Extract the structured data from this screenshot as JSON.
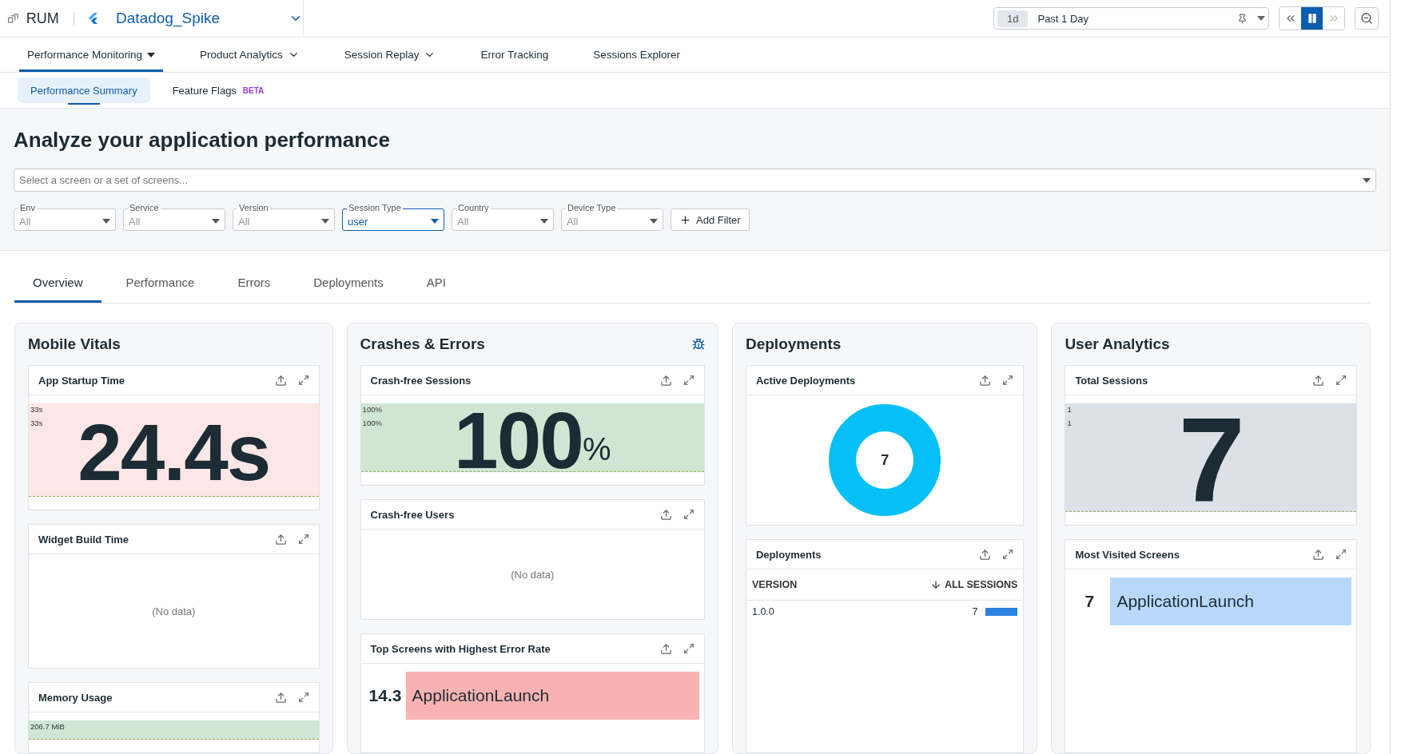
{
  "app_bar": {
    "product": "RUM",
    "application": "Datadog_Spike",
    "time_range": {
      "chip": "1d",
      "label": "Past 1 Day"
    },
    "playback": {
      "paused": true
    }
  },
  "nav": [
    {
      "label": "Performance Monitoring",
      "selected": true,
      "kind": "caret"
    },
    {
      "label": "Product Analytics",
      "selected": false,
      "kind": "chevron"
    },
    {
      "label": "Session Replay",
      "selected": false,
      "kind": "chevron"
    },
    {
      "label": "Error Tracking",
      "selected": false,
      "kind": "plain"
    },
    {
      "label": "Sessions Explorer",
      "selected": false,
      "kind": "plain"
    }
  ],
  "subnav": [
    {
      "label": "Performance Summary",
      "selected": true
    },
    {
      "label": "Feature Flags",
      "selected": false,
      "badge": "BETA"
    }
  ],
  "page_title": "Analyze your application performance",
  "screen_select": {
    "placeholder": "Select a screen or a set of screens..."
  },
  "filters": [
    {
      "label": "Env",
      "value": "All",
      "active": false
    },
    {
      "label": "Service",
      "value": "All",
      "active": false
    },
    {
      "label": "Version",
      "value": "All",
      "active": false
    },
    {
      "label": "Session Type",
      "value": "user",
      "active": true
    },
    {
      "label": "Country",
      "value": "All",
      "active": false
    },
    {
      "label": "Device Type",
      "value": "All",
      "active": false
    }
  ],
  "add_filter": "Add Filter",
  "tabs": [
    {
      "label": "Overview",
      "selected": true
    },
    {
      "label": "Performance",
      "selected": false
    },
    {
      "label": "Errors",
      "selected": false
    },
    {
      "label": "Deployments",
      "selected": false
    },
    {
      "label": "API",
      "selected": false
    }
  ],
  "sections": [
    {
      "title": "Mobile Vitals",
      "widgets": [
        {
          "kind": "value",
          "title": "App Startup Time",
          "color": "#fde6e6",
          "axis": [
            "33s",
            "33s"
          ],
          "value": "24.4s"
        },
        {
          "kind": "nodata",
          "title": "Widget Build Time",
          "message": "(No data)"
        },
        {
          "kind": "value",
          "title": "Memory Usage",
          "color": "#cfe6d2",
          "axis": [
            "206.7 MiB"
          ]
        }
      ]
    },
    {
      "title": "Crashes & Errors",
      "bug_icon": true,
      "widgets": [
        {
          "kind": "value",
          "title": "Crash-free Sessions",
          "color": "#cfe6d2",
          "axis": [
            "100%",
            "100%"
          ],
          "value": "100",
          "unit": "%"
        },
        {
          "kind": "nodata",
          "title": "Crash-free Users",
          "message": "(No data)"
        },
        {
          "kind": "toplist",
          "title": "Top Screens with Highest Error Rate",
          "rows": [
            {
              "value": "14.3",
              "label": "ApplicationLaunch",
              "color": "#f8b2b2"
            }
          ]
        }
      ]
    },
    {
      "title": "Deployments",
      "widgets": [
        {
          "kind": "donut",
          "title": "Active Deployments",
          "center": "7"
        },
        {
          "kind": "table",
          "title": "Deployments",
          "columns": [
            "VERSION",
            "ALL SESSIONS"
          ],
          "rows": [
            {
              "version": "1.0.0",
              "sessions": "7",
              "level": 1
            }
          ]
        }
      ]
    },
    {
      "title": "User Analytics",
      "widgets": [
        {
          "kind": "value",
          "title": "Total Sessions",
          "color": "#dde0e6",
          "axis": [
            "1",
            "1"
          ],
          "value": "7"
        },
        {
          "kind": "toplist",
          "title": "Most Visited Screens",
          "rows": [
            {
              "value": "7",
              "label": "ApplicationLaunch",
              "color": "#b8d8fa"
            }
          ]
        }
      ]
    }
  ]
}
